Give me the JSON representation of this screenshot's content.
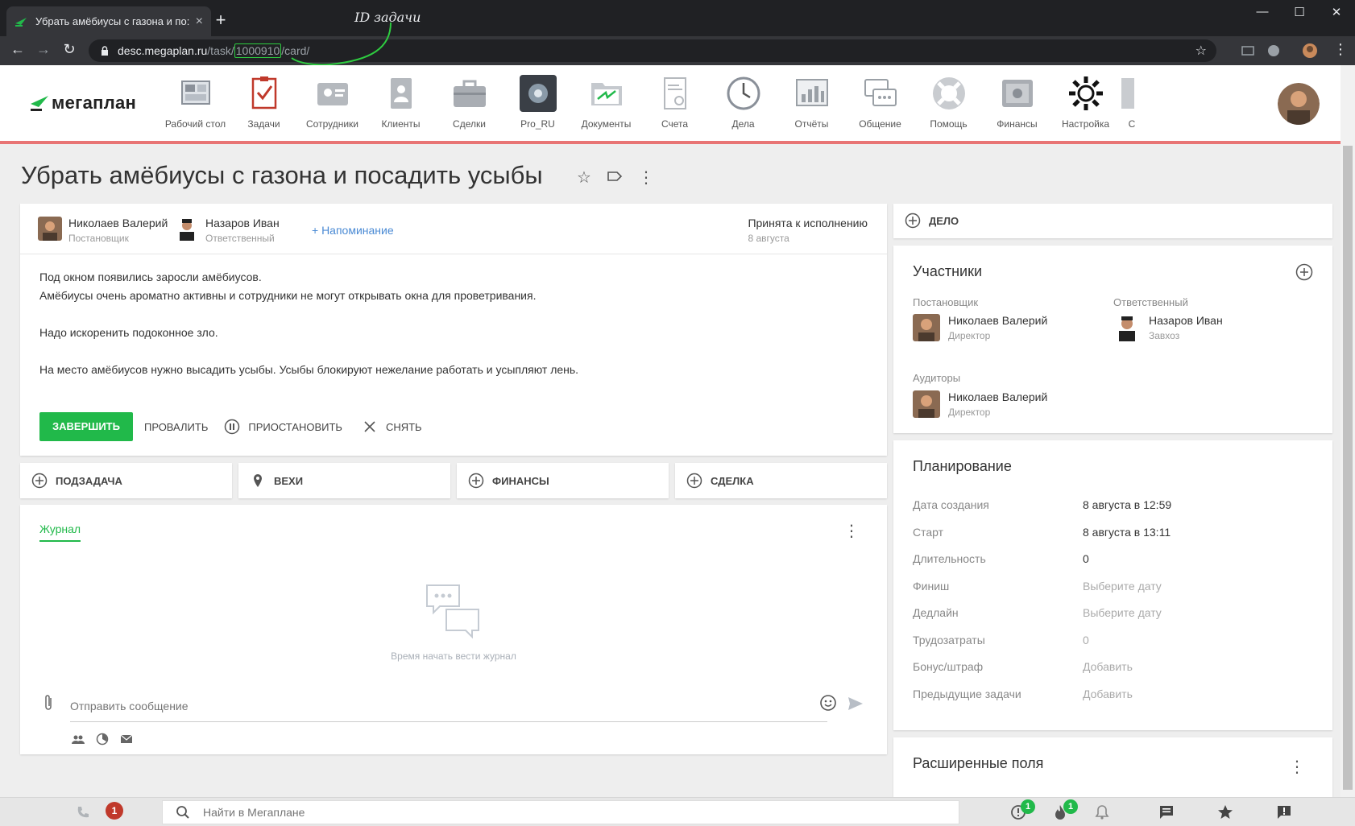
{
  "browser": {
    "tab_title": "Убрать амёбиусы с газона и по:",
    "new_tab": "+",
    "annotation": "ID задачи",
    "url_host": "desc.megaplan.ru",
    "url_path1": "/task/",
    "url_id": "1000910",
    "url_path2": "/card/",
    "win_minimize": "—",
    "win_maximize": "☐",
    "win_close": "✕"
  },
  "header": {
    "logo_text": "мегаплан",
    "modules": [
      {
        "label": "Рабочий стол",
        "icon": "desktop-icon"
      },
      {
        "label": "Задачи",
        "icon": "tasks-icon"
      },
      {
        "label": "Сотрудники",
        "icon": "employees-icon"
      },
      {
        "label": "Клиенты",
        "icon": "clients-icon"
      },
      {
        "label": "Сделки",
        "icon": "deals-icon"
      },
      {
        "label": "Pro_RU",
        "icon": "pro-icon"
      },
      {
        "label": "Документы",
        "icon": "documents-icon"
      },
      {
        "label": "Счета",
        "icon": "invoices-icon"
      },
      {
        "label": "Дела",
        "icon": "clock-icon"
      },
      {
        "label": "Отчёты",
        "icon": "reports-icon"
      },
      {
        "label": "Общение",
        "icon": "chat-icon"
      },
      {
        "label": "Помощь",
        "icon": "help-icon"
      },
      {
        "label": "Финансы",
        "icon": "safe-icon"
      },
      {
        "label": "Настройка",
        "icon": "gear-icon"
      },
      {
        "label": "С",
        "icon": "more-icon"
      }
    ]
  },
  "task": {
    "title": "Убрать амёбиусы с газона и посадить усыбы",
    "owner": {
      "name": "Николаев Валерий",
      "role": "Постановщик"
    },
    "responsible": {
      "name": "Назаров Иван",
      "role": "Ответственный"
    },
    "reminder": "+ Напоминание",
    "status": "Принята к исполнению",
    "status_date": "8 августа",
    "description": [
      "Под окном появились заросли амёбиусов.",
      "Амёбиусы очень ароматно активны и сотрудники не могут открывать окна для проветривания.",
      "Надо искоренить подоконное зло.",
      "На место амёбиусов нужно высадить усыбы. Усыбы блокируют нежелание работать и усыпляют лень."
    ],
    "actions": {
      "complete": "ЗАВЕРШИТЬ",
      "fail": "ПРОВАЛИТЬ",
      "pause": "ПРИОСТАНОВИТЬ",
      "remove": "СНЯТЬ"
    }
  },
  "subactions": {
    "subtask": "ПОДЗАДАЧА",
    "milestones": "ВЕХИ",
    "finance": "ФИНАНСЫ",
    "deal": "СДЕЛКА"
  },
  "journal": {
    "tab": "Журнал",
    "empty": "Время начать вести журнал",
    "placeholder": "Отправить сообщение"
  },
  "right": {
    "delo": "ДЕЛО",
    "participants_title": "Участники",
    "owner_label": "Постановщик",
    "owner_name": "Николаев Валерий",
    "owner_role": "Директор",
    "resp_label": "Ответственный",
    "resp_name": "Назаров Иван",
    "resp_role": "Завхоз",
    "auditors_label": "Аудиторы",
    "auditor_name": "Николаев Валерий",
    "auditor_role": "Директор",
    "planning_title": "Планирование",
    "planning": [
      {
        "label": "Дата создания",
        "value": "8 августа в 12:59",
        "muted": false
      },
      {
        "label": "Старт",
        "value": "8 августа в 13:11",
        "muted": false
      },
      {
        "label": "Длительность",
        "value": "0",
        "muted": false
      },
      {
        "label": "Финиш",
        "value": "Выберите дату",
        "muted": true
      },
      {
        "label": "Дедлайн",
        "value": "Выберите дату",
        "muted": true
      },
      {
        "label": "Трудозатраты",
        "value": "0",
        "muted": true
      },
      {
        "label": "Бонус/штраф",
        "value": "Добавить",
        "muted": true
      },
      {
        "label": "Предыдущие задачи",
        "value": "Добавить",
        "muted": true
      }
    ],
    "ext_title": "Расширенные поля"
  },
  "bottombar": {
    "calls_badge": "1",
    "search_placeholder": "Найти в Мегаплане",
    "alerts_badge": "1",
    "hot_badge": "1"
  },
  "colors": {
    "accent": "#21b94a",
    "header_line": "#e87474",
    "link": "#4a8ad4"
  }
}
